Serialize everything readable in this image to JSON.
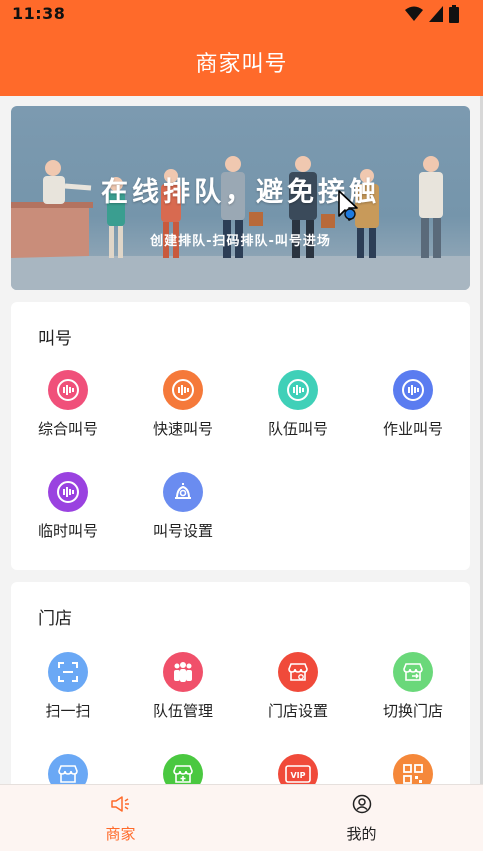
{
  "status_bar": {
    "time": "11:38"
  },
  "header": {
    "title": "商家叫号"
  },
  "banner": {
    "headline": "在线排队，避免接触",
    "subline": "创建排队-扫码排队-叫号进场"
  },
  "call_section": {
    "title": "叫号",
    "items": [
      {
        "label": "综合叫号",
        "icon": "sound-wave-icon",
        "color": "#f0507a"
      },
      {
        "label": "快速叫号",
        "icon": "sound-wave-icon",
        "color": "#f5793a"
      },
      {
        "label": "队伍叫号",
        "icon": "sound-wave-icon",
        "color": "#3fd0b8"
      },
      {
        "label": "作业叫号",
        "icon": "sound-wave-icon",
        "color": "#5a7cf0"
      },
      {
        "label": "临时叫号",
        "icon": "sound-wave-icon",
        "color": "#9a42e0"
      },
      {
        "label": "叫号设置",
        "icon": "bell-settings-icon",
        "color": "#6a8cf0"
      }
    ]
  },
  "store_section": {
    "title": "门店",
    "items": [
      {
        "label": "扫一扫",
        "icon": "scan-icon",
        "color": "#6aa8f5"
      },
      {
        "label": "队伍管理",
        "icon": "team-icon",
        "color": "#f0506a"
      },
      {
        "label": "门店设置",
        "icon": "store-settings-icon",
        "color": "#f04a3a"
      },
      {
        "label": "切换门店",
        "icon": "store-switch-icon",
        "color": "#6ad87a"
      },
      {
        "label": "",
        "icon": "store-icon",
        "color": "#6aa8f5"
      },
      {
        "label": "",
        "icon": "store-add-icon",
        "color": "#4ac840"
      },
      {
        "label": "",
        "icon": "vip-icon",
        "color": "#f04a3a"
      },
      {
        "label": "",
        "icon": "qrcode-icon",
        "color": "#f5883a"
      }
    ]
  },
  "tabbar": {
    "items": [
      {
        "label": "商家",
        "icon": "megaphone-icon",
        "active": true
      },
      {
        "label": "我的",
        "icon": "user-icon",
        "active": false
      }
    ]
  },
  "colors": {
    "brand": "#ff6a2a"
  }
}
